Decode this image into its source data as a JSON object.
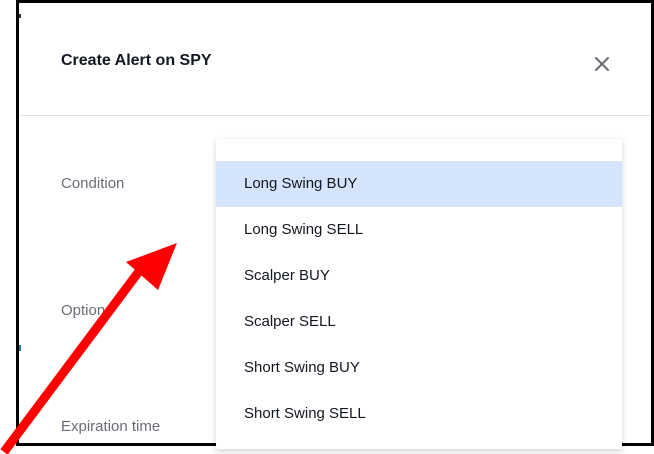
{
  "dialog": {
    "title": "Create Alert on SPY",
    "close_icon": "close-icon"
  },
  "form": {
    "condition_label": "Condition",
    "options_label": "Options",
    "expiration_label": "Expiration time"
  },
  "dropdown": {
    "highlighted_index": 0,
    "items": [
      {
        "label": "Long Swing BUY"
      },
      {
        "label": "Long Swing SELL"
      },
      {
        "label": "Scalper BUY"
      },
      {
        "label": "Scalper SELL"
      },
      {
        "label": "Short Swing BUY"
      },
      {
        "label": "Short Swing SELL"
      }
    ]
  },
  "annotation": {
    "arrow_color": "#ff0000",
    "arrow_icon": "red-arrow-annotation"
  },
  "colors": {
    "highlight": "#d4e4fc",
    "title": "#131722",
    "label": "#6a6d78",
    "divider": "#e0e3eb"
  }
}
